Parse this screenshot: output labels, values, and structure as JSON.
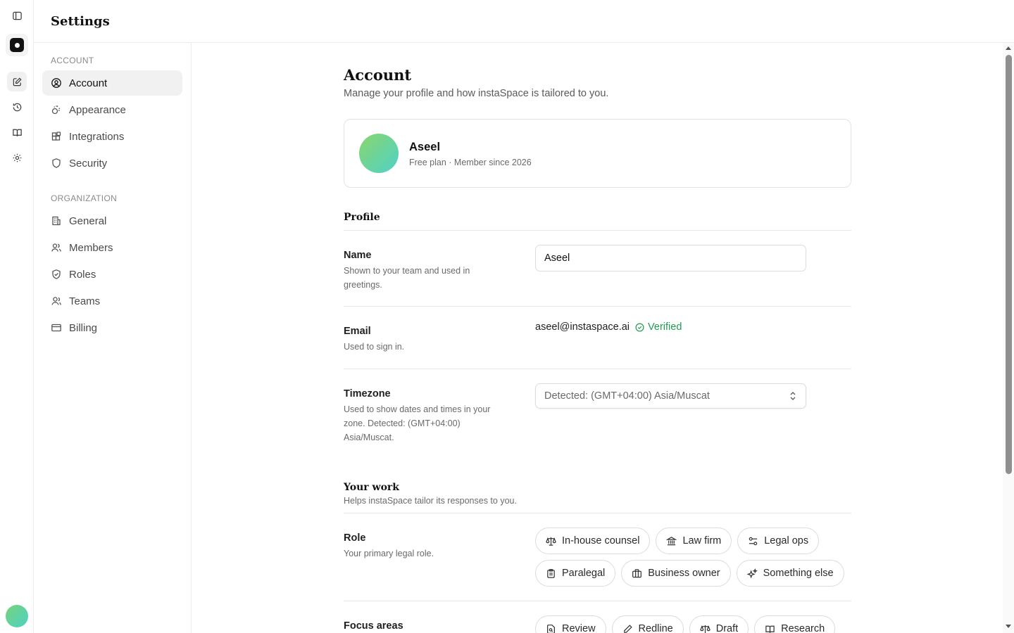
{
  "header": {
    "title": "Settings"
  },
  "sidebar": {
    "sections": [
      {
        "title": "ACCOUNT",
        "items": [
          {
            "label": "Account",
            "icon": "user-circle-icon",
            "active": true
          },
          {
            "label": "Appearance",
            "icon": "palette-icon"
          },
          {
            "label": "Integrations",
            "icon": "blocks-icon"
          },
          {
            "label": "Security",
            "icon": "shield-icon"
          }
        ]
      },
      {
        "title": "ORGANIZATION",
        "items": [
          {
            "label": "General",
            "icon": "building-icon"
          },
          {
            "label": "Members",
            "icon": "users-icon"
          },
          {
            "label": "Roles",
            "icon": "shield-check-icon"
          },
          {
            "label": "Teams",
            "icon": "team-icon"
          },
          {
            "label": "Billing",
            "icon": "credit-card-icon"
          }
        ]
      }
    ]
  },
  "page": {
    "title": "Account",
    "subtitle": "Manage your profile and how instaSpace is tailored to you."
  },
  "profile_card": {
    "name": "Aseel",
    "meta": "Free plan · Member since 2026"
  },
  "profile_section": {
    "title": "Profile",
    "name_field": {
      "label": "Name",
      "help": "Shown to your team and used in greetings.",
      "value": "Aseel"
    },
    "email_field": {
      "label": "Email",
      "help": "Used to sign in.",
      "value": "aseel@instaspace.ai",
      "status": "Verified"
    },
    "timezone_field": {
      "label": "Timezone",
      "help": "Used to show dates and times in your zone. Detected: (GMT+04:00) Asia/Muscat.",
      "value": "Detected: (GMT+04:00) Asia/Muscat"
    }
  },
  "work_section": {
    "title": "Your work",
    "description": "Helps instaSpace tailor its responses to you.",
    "role": {
      "label": "Role",
      "help": "Your primary legal role.",
      "options": [
        "In-house counsel",
        "Law firm",
        "Legal ops",
        "Paralegal",
        "Business owner",
        "Something else"
      ]
    },
    "focus": {
      "label": "Focus areas",
      "options": [
        "Review",
        "Redline",
        "Draft",
        "Research"
      ]
    }
  },
  "colors": {
    "verified": "#1f9d55",
    "avatar_gradient_start": "#8bd66b",
    "avatar_gradient_end": "#4ed2c9"
  }
}
